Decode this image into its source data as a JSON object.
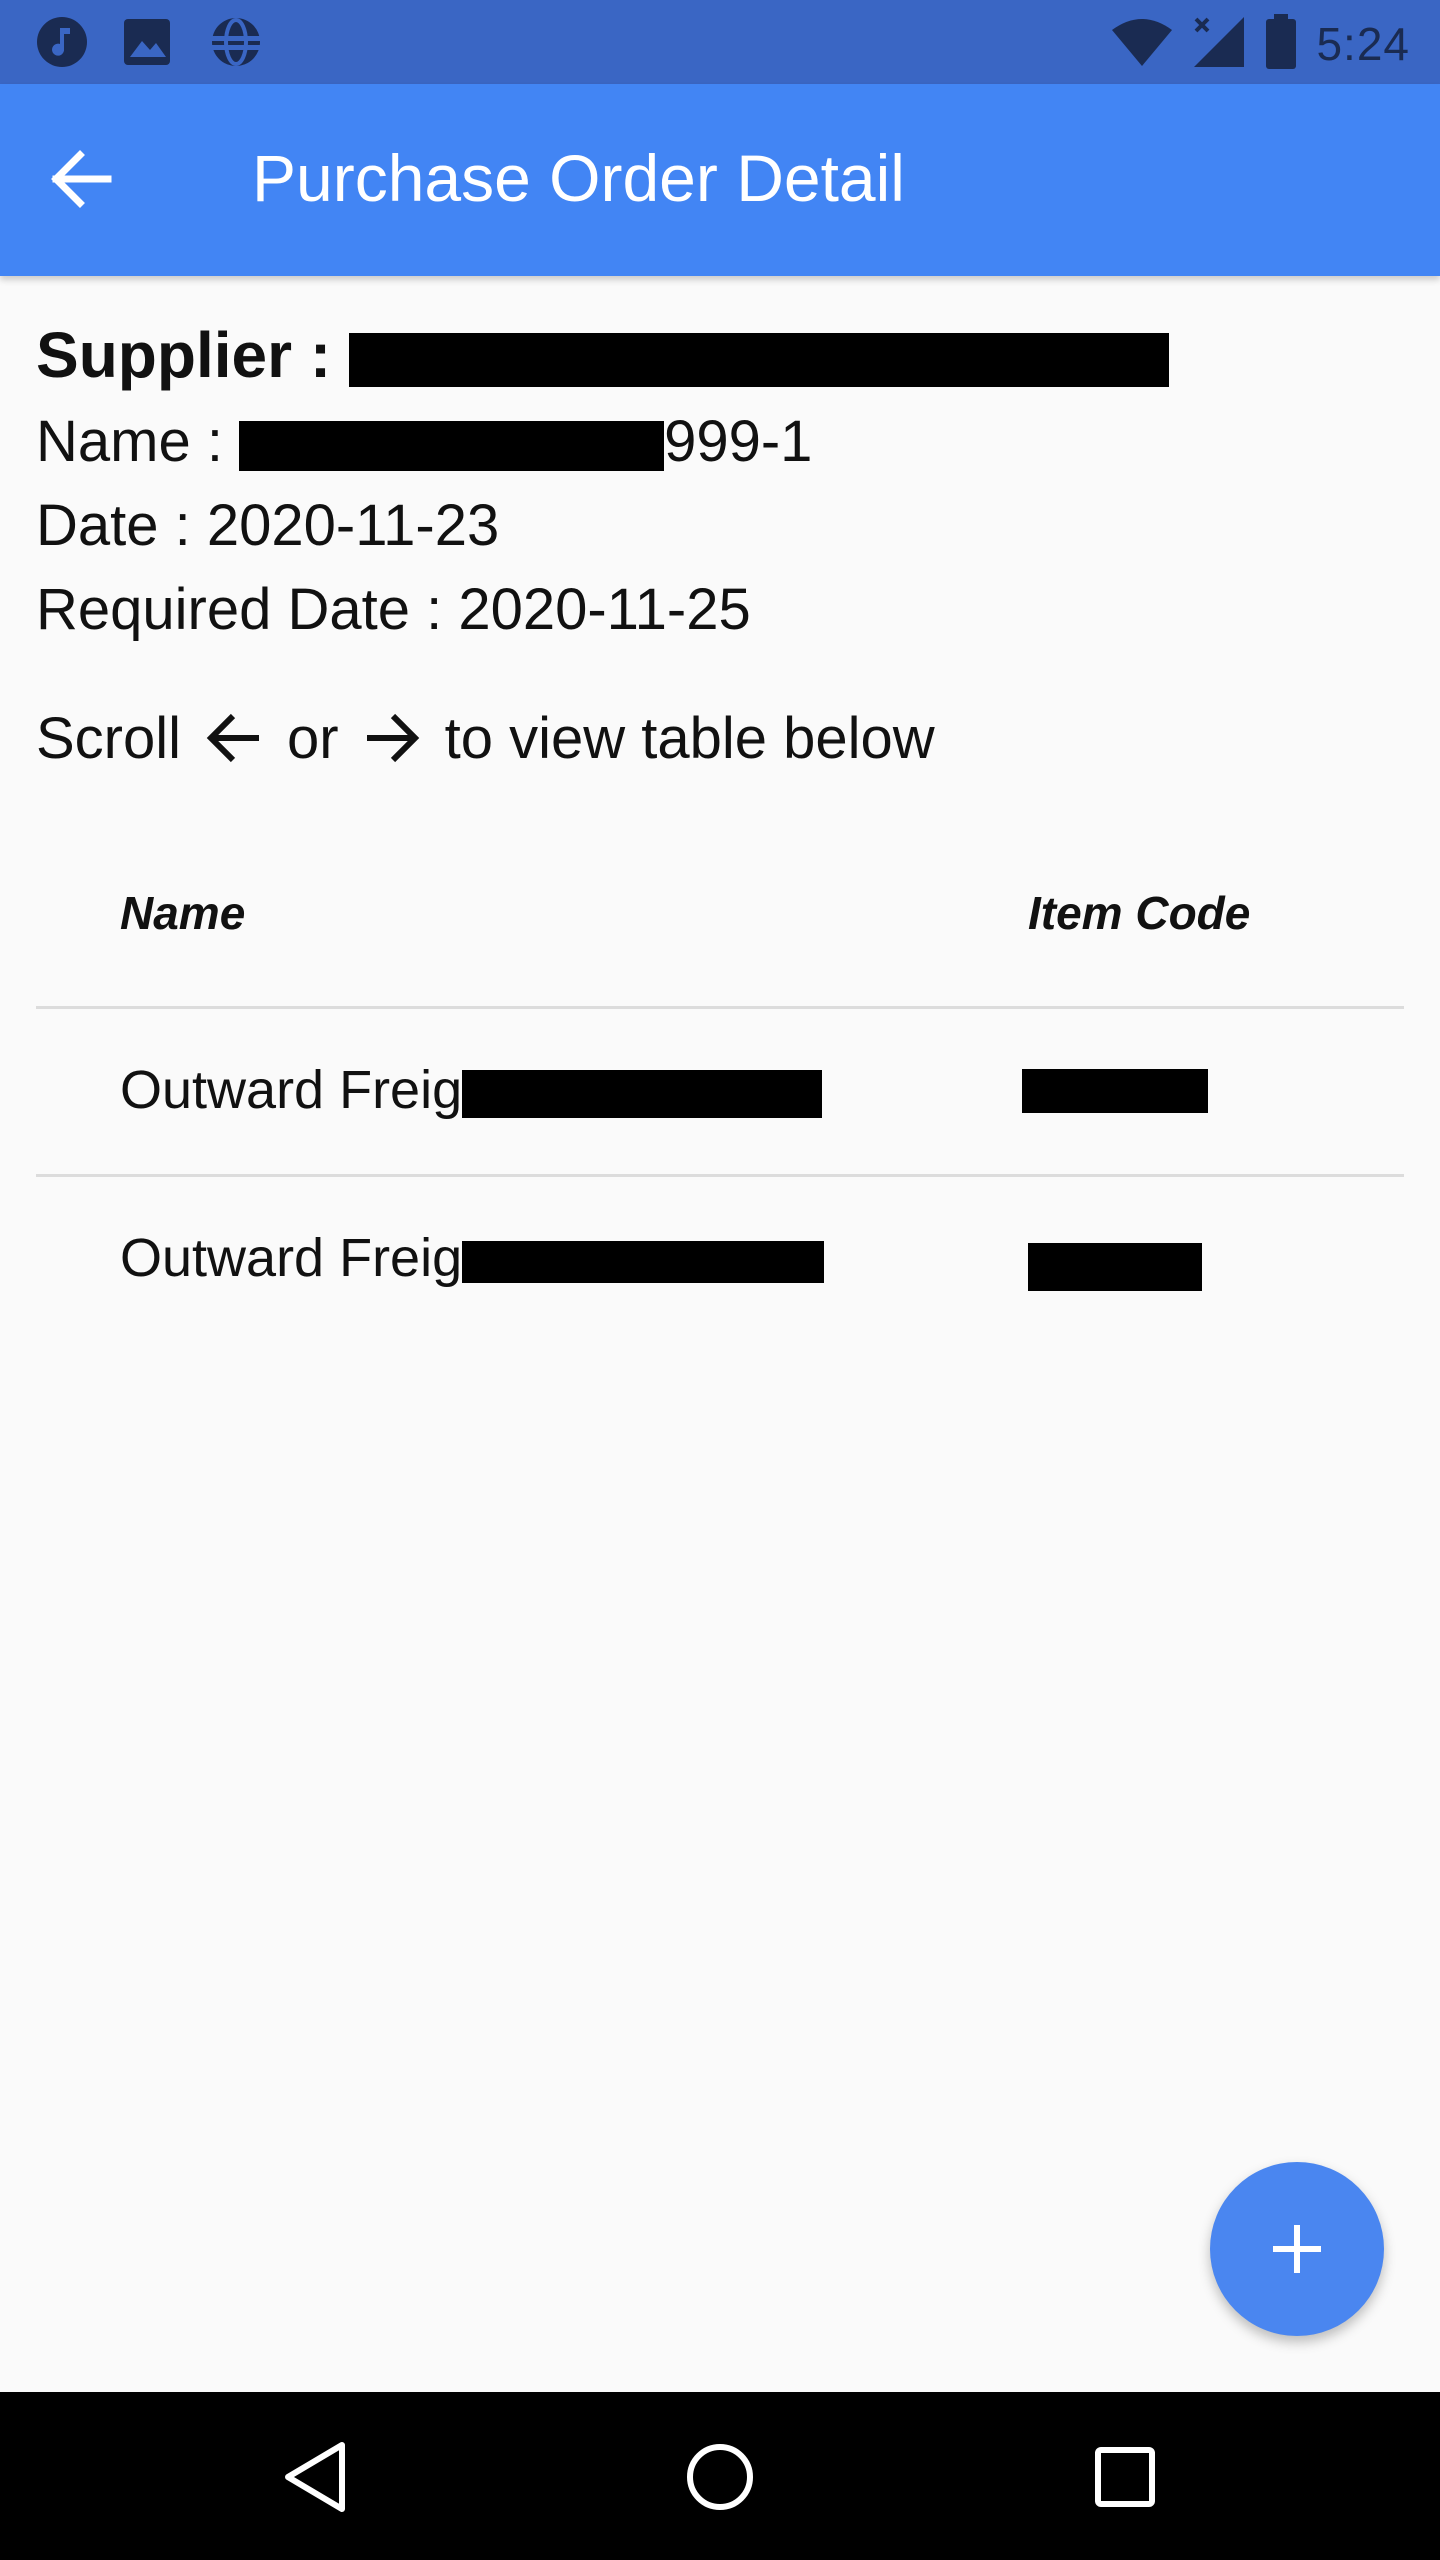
{
  "status_bar": {
    "time": "5:24",
    "left_icons": [
      "music-note-icon",
      "image-icon",
      "vpn-globe-icon"
    ],
    "right_icons": [
      "wifi-icon",
      "signal-icon",
      "battery-icon"
    ],
    "bg_color": "#3a66c4"
  },
  "app_bar": {
    "title": "Purchase Order Detail",
    "bg_color": "#4285f4"
  },
  "details": {
    "supplier_label": "Supplier : ",
    "name_label": "Name : ",
    "name_value_suffix": "999-1",
    "date_label": "Date : ",
    "date_value": "2020-11-23",
    "required_date_label": "Required Date : ",
    "required_date_value": "2020-11-25"
  },
  "scroll_hint": {
    "prefix": "Scroll",
    "or": "or",
    "suffix": "to view table below"
  },
  "table": {
    "headers": [
      "Name",
      "Item Code"
    ],
    "rows": [
      {
        "name_visible": "Outward Freig"
      },
      {
        "name_visible": "Outward Freig"
      }
    ]
  },
  "fab": {
    "icon": "plus-icon",
    "color": "#4a86f0"
  },
  "nav_bar": {
    "buttons": [
      "back-triangle-icon",
      "home-circle-icon",
      "recents-square-icon"
    ]
  }
}
